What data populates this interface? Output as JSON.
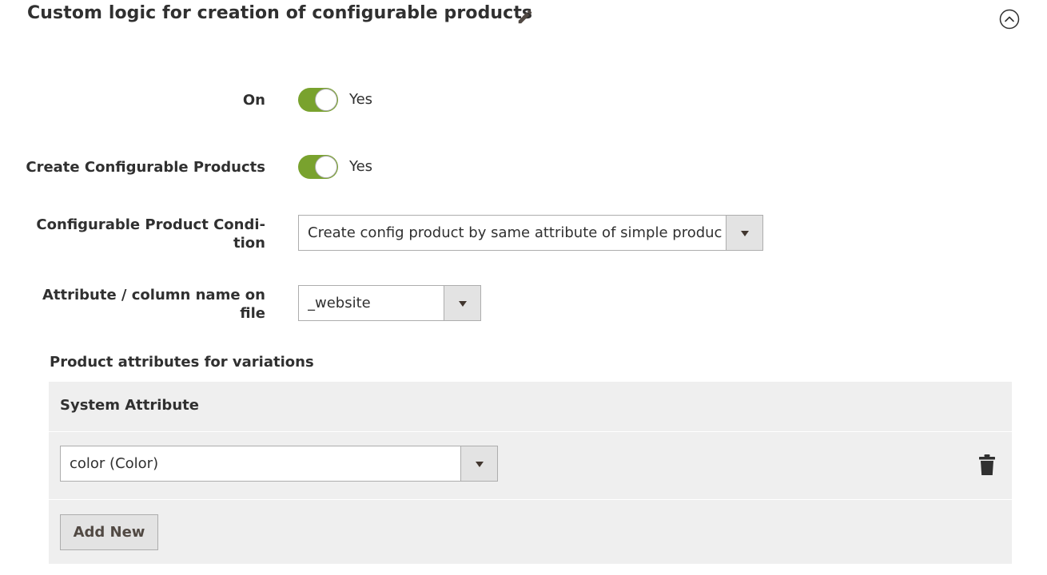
{
  "section": {
    "title": "Custom logic for creation of configurable products",
    "edit_icon": "pencil-icon",
    "collapse_icon": "chevron-up-circle-icon"
  },
  "fields": {
    "on": {
      "label": "On",
      "value": "Yes",
      "checked": true
    },
    "create_configurable": {
      "label": "Create Configurable Products",
      "value": "Yes",
      "checked": true
    },
    "condition": {
      "label_line1": "Configurable Product Condi-",
      "label_line2": "tion",
      "selected": "Create config product by same attribute of simple produc"
    },
    "attribute_column": {
      "label_line1": "Attribute / column name on",
      "label_line2": "file",
      "selected": "_website"
    }
  },
  "variations": {
    "heading": "Product attributes for variations",
    "column_header": "System Attribute",
    "rows": [
      {
        "selected": "color (Color)",
        "delete_icon": "trash-icon"
      }
    ],
    "add_label": "Add New"
  },
  "colors": {
    "toggle_on": "#79a22e",
    "table_bg": "#efefef",
    "button_bg": "#e3e3e3",
    "border": "#adadad"
  }
}
